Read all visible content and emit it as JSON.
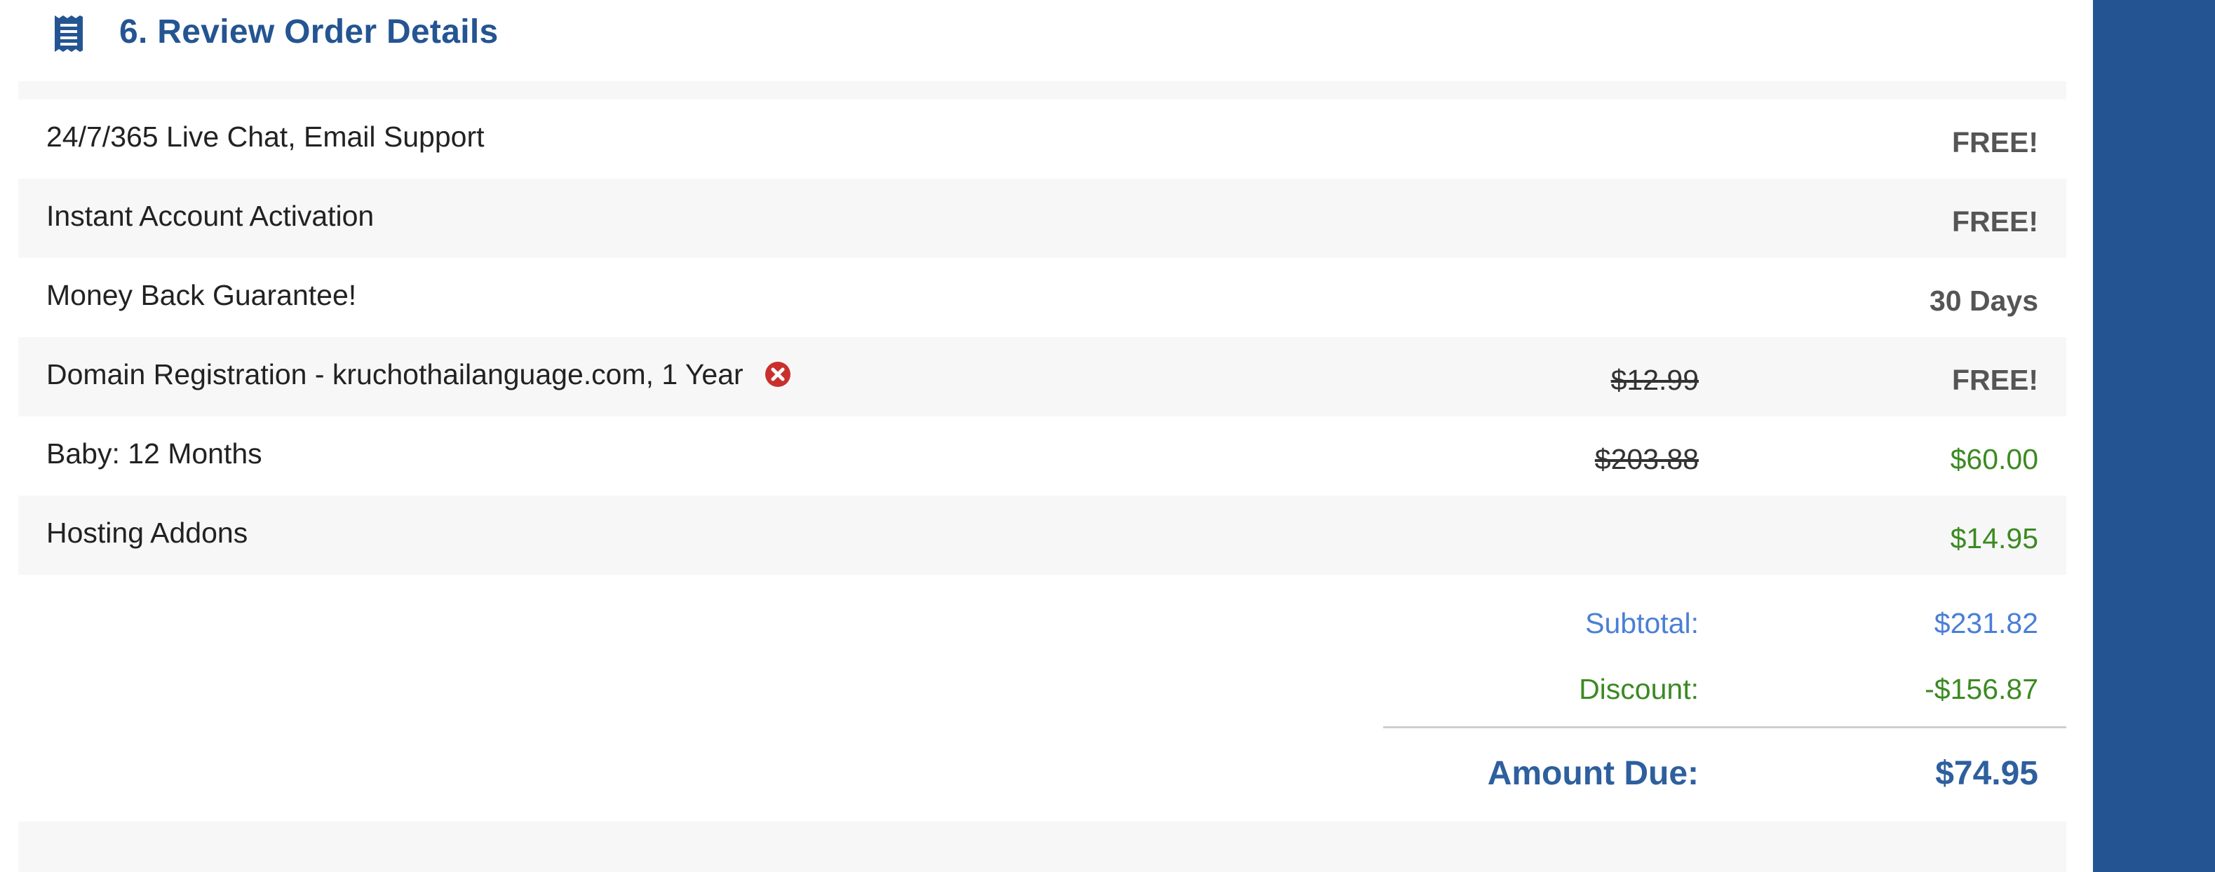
{
  "section": {
    "title": "6. Review Order Details",
    "icon": "receipt-icon"
  },
  "items": [
    {
      "label": "24/7/365 Live Chat, Email Support",
      "old_price": "",
      "price": "FREE!"
    },
    {
      "label": "Instant Account Activation",
      "old_price": "",
      "price": "FREE!"
    },
    {
      "label": "Money Back Guarantee!",
      "old_price": "",
      "price": "30 Days"
    },
    {
      "label": "Domain Registration - kruchothailanguage.com, 1 Year",
      "old_price": "$12.99",
      "price": "FREE!",
      "removable": true
    },
    {
      "label": "Baby: 12 Months",
      "old_price": "$203.88",
      "price": "$60.00"
    },
    {
      "label": "Hosting Addons",
      "old_price": "",
      "price": "$14.95"
    }
  ],
  "totals": {
    "subtotal_label": "Subtotal:",
    "subtotal_value": "$231.82",
    "discount_label": "Discount:",
    "discount_value": "-$156.87",
    "amount_due_label": "Amount Due:",
    "amount_due_value": "$74.95"
  },
  "colors": {
    "brand_blue": "#245592",
    "link_blue": "#4a7fd6",
    "success_green": "#3b8a22",
    "remove_red": "#c9302c",
    "row_alt": "#f7f7f7"
  }
}
